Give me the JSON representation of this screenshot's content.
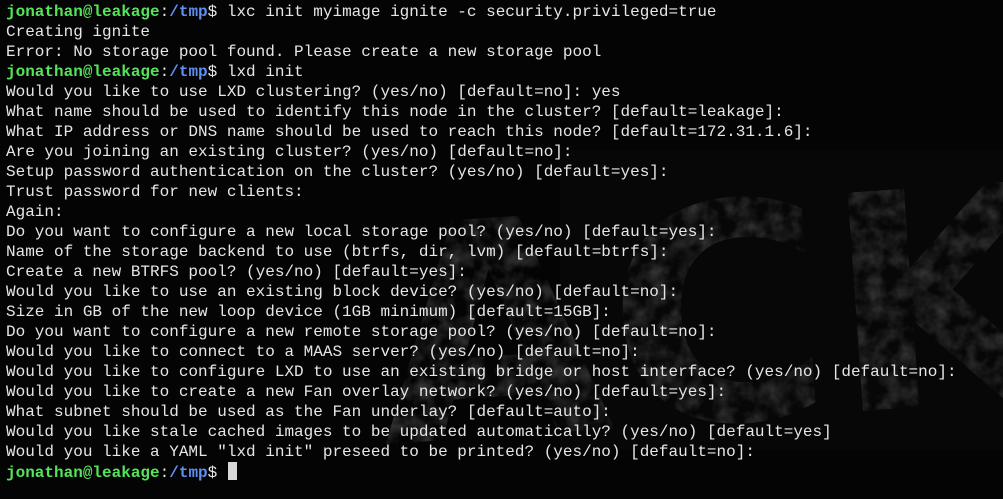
{
  "terminal": {
    "prompt": {
      "user_host": "jonathan@leakage",
      "colon": ":",
      "path": "/tmp",
      "suffix": "$ "
    },
    "lines": [
      {
        "type": "prompt",
        "command": "lxc init myimage ignite -c security.privileged=true"
      },
      {
        "type": "output",
        "text": "Creating ignite"
      },
      {
        "type": "output",
        "text": "Error: No storage pool found. Please create a new storage pool"
      },
      {
        "type": "prompt",
        "command": "lxd init"
      },
      {
        "type": "output",
        "text": "Would you like to use LXD clustering? (yes/no) [default=no]: yes"
      },
      {
        "type": "output",
        "text": "What name should be used to identify this node in the cluster? [default=leakage]:"
      },
      {
        "type": "output",
        "text": "What IP address or DNS name should be used to reach this node? [default=172.31.1.6]:"
      },
      {
        "type": "output",
        "text": "Are you joining an existing cluster? (yes/no) [default=no]:"
      },
      {
        "type": "output",
        "text": "Setup password authentication on the cluster? (yes/no) [default=yes]:"
      },
      {
        "type": "output",
        "text": "Trust password for new clients:"
      },
      {
        "type": "output",
        "text": "Again:"
      },
      {
        "type": "output",
        "text": "Do you want to configure a new local storage pool? (yes/no) [default=yes]:"
      },
      {
        "type": "output",
        "text": "Name of the storage backend to use (btrfs, dir, lvm) [default=btrfs]:"
      },
      {
        "type": "output",
        "text": "Create a new BTRFS pool? (yes/no) [default=yes]:"
      },
      {
        "type": "output",
        "text": "Would you like to use an existing block device? (yes/no) [default=no]:"
      },
      {
        "type": "output",
        "text": "Size in GB of the new loop device (1GB minimum) [default=15GB]:"
      },
      {
        "type": "output",
        "text": "Do you want to configure a new remote storage pool? (yes/no) [default=no]:"
      },
      {
        "type": "output",
        "text": "Would you like to connect to a MAAS server? (yes/no) [default=no]:"
      },
      {
        "type": "output",
        "text": "Would you like to configure LXD to use an existing bridge or host interface? (yes/no) [default=no]:"
      },
      {
        "type": "output",
        "text": "Would you like to create a new Fan overlay network? (yes/no) [default=yes]:"
      },
      {
        "type": "output",
        "text": "What subnet should be used as the Fan underlay? [default=auto]:"
      },
      {
        "type": "output",
        "text": "Would you like stale cached images to be updated automatically? (yes/no) [default=yes]"
      },
      {
        "type": "output",
        "text": "Would you like a YAML \"lxd init\" preseed to be printed? (yes/no) [default=no]:"
      },
      {
        "type": "prompt",
        "command": ""
      }
    ],
    "background_art_text": "ACK",
    "colors": {
      "background": "#040404",
      "text": "#e6e6e6",
      "user_host": "#55e35a",
      "path": "#5f8ff0",
      "cursor": "#d8d8d8"
    }
  }
}
